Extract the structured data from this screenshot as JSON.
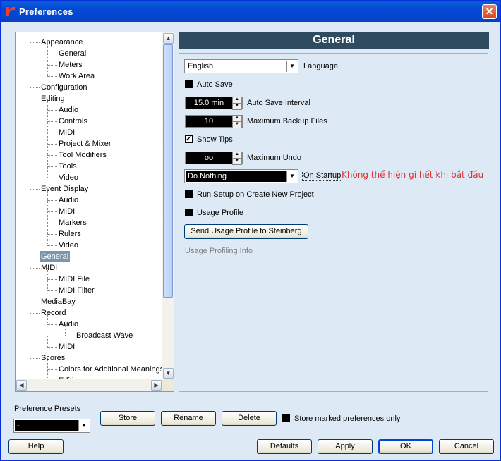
{
  "window": {
    "title": "Preferences",
    "close_glyph": "✕"
  },
  "tree": {
    "items": [
      {
        "label": "Appearance",
        "level": 1
      },
      {
        "label": "General",
        "level": 2
      },
      {
        "label": "Meters",
        "level": 2
      },
      {
        "label": "Work Area",
        "level": 2
      },
      {
        "label": "Configuration",
        "level": 1
      },
      {
        "label": "Editing",
        "level": 1
      },
      {
        "label": "Audio",
        "level": 2
      },
      {
        "label": "Controls",
        "level": 2
      },
      {
        "label": "MIDI",
        "level": 2
      },
      {
        "label": "Project & Mixer",
        "level": 2
      },
      {
        "label": "Tool Modifiers",
        "level": 2
      },
      {
        "label": "Tools",
        "level": 2
      },
      {
        "label": "Video",
        "level": 2
      },
      {
        "label": "Event Display",
        "level": 1
      },
      {
        "label": "Audio",
        "level": 2
      },
      {
        "label": "MIDI",
        "level": 2
      },
      {
        "label": "Markers",
        "level": 2
      },
      {
        "label": "Rulers",
        "level": 2
      },
      {
        "label": "Video",
        "level": 2
      },
      {
        "label": "General",
        "level": 1,
        "selected": true
      },
      {
        "label": "MIDI",
        "level": 1
      },
      {
        "label": "MIDI File",
        "level": 2
      },
      {
        "label": "MIDI Filter",
        "level": 2
      },
      {
        "label": "MediaBay",
        "level": 1
      },
      {
        "label": "Record",
        "level": 1
      },
      {
        "label": "Audio",
        "level": 2
      },
      {
        "label": "Broadcast Wave",
        "level": 3
      },
      {
        "label": "MIDI",
        "level": 2
      },
      {
        "label": "Scores",
        "level": 1
      },
      {
        "label": "Colors for Additional Meanings",
        "level": 2
      },
      {
        "label": "Editing",
        "level": 2
      }
    ]
  },
  "panel": {
    "header": "General",
    "language": {
      "value": "English",
      "label": "Language"
    },
    "auto_save": {
      "label": "Auto Save",
      "checked": false
    },
    "auto_save_interval": {
      "value": "15.0 min",
      "label": "Auto Save Interval"
    },
    "max_backup": {
      "value": "10",
      "label": "Maximum Backup Files"
    },
    "show_tips": {
      "label": "Show Tips",
      "checked": true,
      "check_glyph": "✓"
    },
    "max_undo": {
      "value": "oo",
      "label": "Maximum Undo"
    },
    "on_startup": {
      "value": "Do Nothing",
      "label": "On Startup",
      "annotation": "Không thể hiện gì hết khi bắt đầu"
    },
    "run_setup": {
      "label": "Run Setup on Create New Project",
      "checked": false
    },
    "usage_profile": {
      "label": "Usage Profile",
      "checked": false
    },
    "send_usage_button": "Send Usage Profile to Steinberg",
    "usage_info_link": "Usage Profiling Info"
  },
  "presets": {
    "label": "Preference Presets",
    "value": "-",
    "store": "Store",
    "rename": "Rename",
    "delete": "Delete",
    "store_marked_label": "Store marked preferences only",
    "store_marked_checked": false
  },
  "buttons": {
    "help": "Help",
    "defaults": "Defaults",
    "apply": "Apply",
    "ok": "OK",
    "cancel": "Cancel"
  },
  "glyphs": {
    "up": "▲",
    "down": "▼",
    "left": "◀",
    "right": "▶"
  }
}
